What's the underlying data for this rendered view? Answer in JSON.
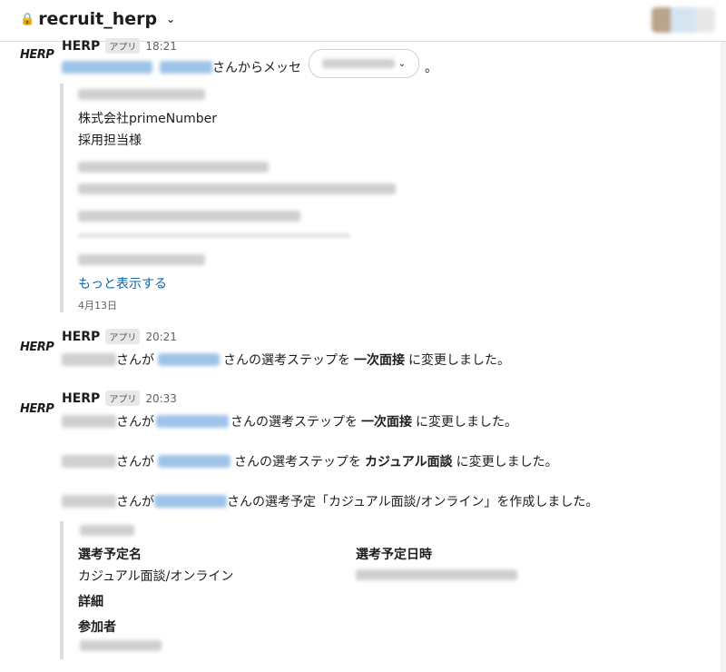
{
  "header": {
    "channel_name": "recruit_herp",
    "lock_icon": "lock-icon",
    "chevron": "chevron-down-icon"
  },
  "messages": [
    {
      "logo": "HERP",
      "sender": "HERP",
      "badge": "アプリ",
      "time": "18:21",
      "text_suffix": "さんからメッセ",
      "text_end": "。",
      "quote": {
        "company": "株式会社primeNumber",
        "recipient": "採用担当様",
        "show_more": "もっと表示する",
        "date": "4月13日"
      }
    },
    {
      "logo": "HERP",
      "sender": "HERP",
      "badge": "アプリ",
      "time": "20:21",
      "lines": [
        {
          "a": "さんが",
          "b": "さんの選考ステップを",
          "bold": "一次面接",
          "c": "に変更しました。"
        }
      ]
    },
    {
      "logo": "HERP",
      "sender": "HERP",
      "badge": "アプリ",
      "time": "20:33",
      "lines": [
        {
          "a": "さんが",
          "b": "さんの選考ステップを",
          "bold": "一次面接",
          "c": "に変更しました。"
        },
        {
          "a": "さんが",
          "b": "さんの選考ステップを",
          "bold": "カジュアル面談",
          "c": "に変更しました。"
        },
        {
          "a": "さんが",
          "b": "さんの選考予定「カジュアル面談/オンライン」を作成しました。"
        }
      ],
      "schedule": {
        "name_label": "選考予定名",
        "name_value": "カジュアル面談/オンライン",
        "date_label": "選考予定日時",
        "detail_label": "詳細",
        "participants_label": "参加者"
      }
    }
  ]
}
